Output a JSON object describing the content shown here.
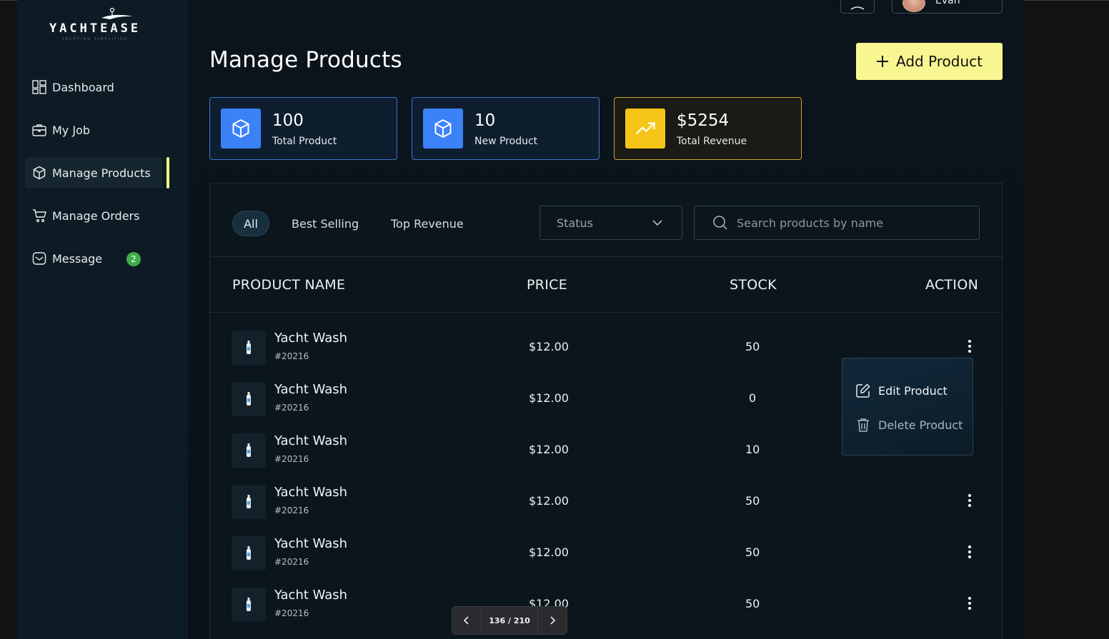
{
  "brand": {
    "name": "YACHTEASE",
    "tagline": "YACHTING SIMPLIFIED"
  },
  "sidebar": {
    "items": [
      {
        "label": "Dashboard",
        "icon": "dashboard-icon"
      },
      {
        "label": "My Job",
        "icon": "briefcase-icon"
      },
      {
        "label": "Manage Products",
        "icon": "box-icon",
        "active": true
      },
      {
        "label": "Manage Orders",
        "icon": "cart-icon"
      },
      {
        "label": "Message",
        "icon": "message-icon",
        "badge": "2"
      }
    ]
  },
  "header": {
    "user_name": "Evan"
  },
  "page": {
    "title": "Manage Products",
    "add_button": "Add Product"
  },
  "stats": [
    {
      "value": "100",
      "label": "Total Product",
      "icon": "box-icon",
      "color": "#3b82f6"
    },
    {
      "value": "10",
      "label": "New Product",
      "icon": "box-icon",
      "color": "#3b82f6"
    },
    {
      "value": "$5254",
      "label": "Total Revenue",
      "icon": "trending-up-icon",
      "color": "#f5c518"
    }
  ],
  "filters": {
    "tabs": [
      "All",
      "Best Selling",
      "Top Revenue"
    ],
    "active_tab": "All",
    "status_placeholder": "Status",
    "search_placeholder": "Search products by name"
  },
  "table": {
    "columns": [
      "PRODUCT NAME",
      "PRICE",
      "STOCK",
      "ACTION"
    ],
    "rows": [
      {
        "name": "Yacht Wash",
        "sku": "#20216",
        "price": "$12.00",
        "stock": "50"
      },
      {
        "name": "Yacht Wash",
        "sku": "#20216",
        "price": "$12.00",
        "stock": "0"
      },
      {
        "name": "Yacht Wash",
        "sku": "#20216",
        "price": "$12.00",
        "stock": "10"
      },
      {
        "name": "Yacht Wash",
        "sku": "#20216",
        "price": "$12.00",
        "stock": "50"
      },
      {
        "name": "Yacht Wash",
        "sku": "#20216",
        "price": "$12.00",
        "stock": "50"
      },
      {
        "name": "Yacht Wash",
        "sku": "#20216",
        "price": "$12.00",
        "stock": "50"
      }
    ]
  },
  "action_menu": {
    "edit": "Edit Product",
    "delete": "Delete Product"
  },
  "pagination": {
    "text": "136 / 210"
  },
  "colors": {
    "accent": "#f8f691",
    "primary": "#3b82f6",
    "revenue": "#f5c518",
    "badge": "#3fae48"
  }
}
